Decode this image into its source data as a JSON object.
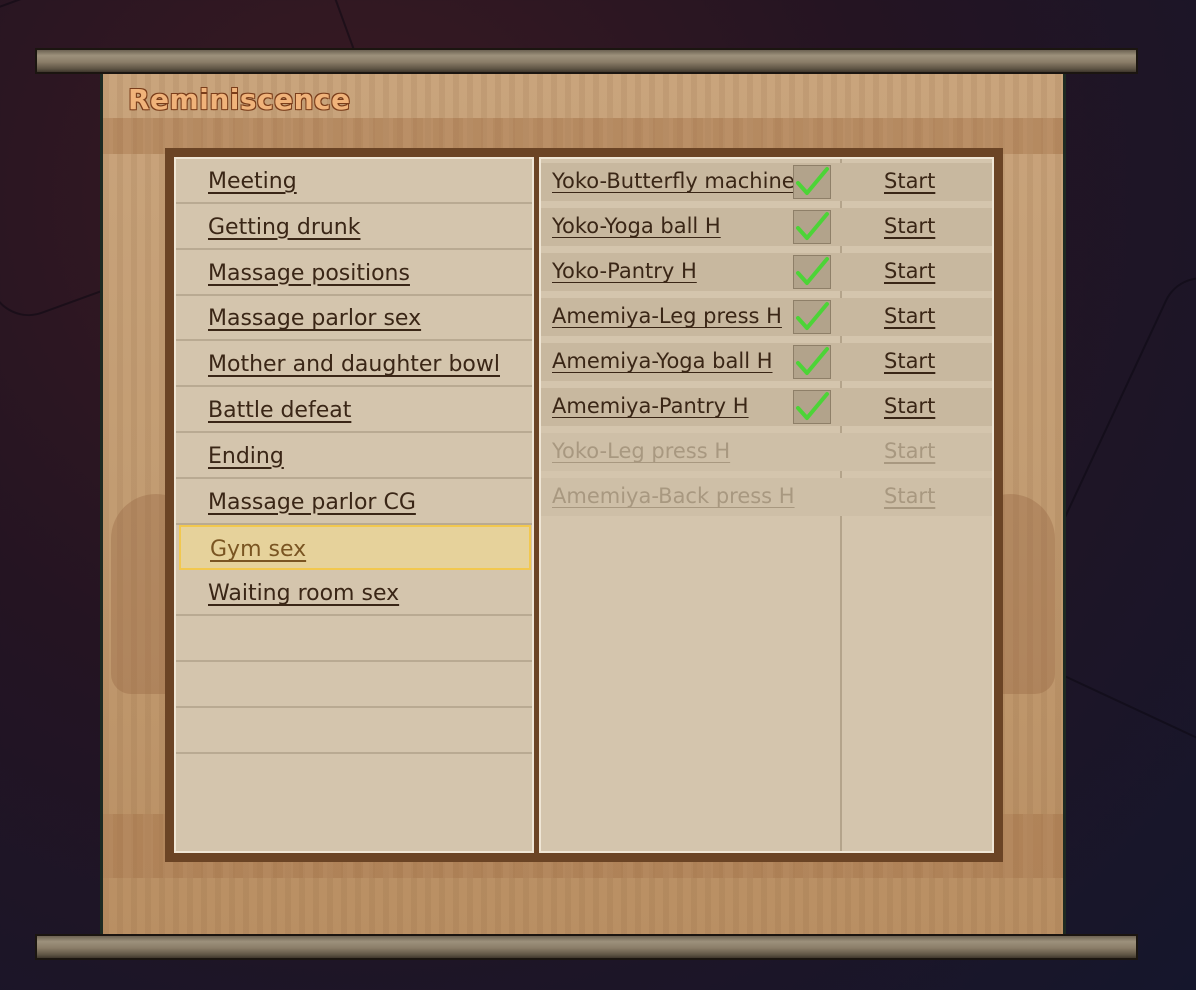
{
  "screen": {
    "title": "Reminiscence"
  },
  "categories": [
    {
      "label": "Meeting"
    },
    {
      "label": "Getting drunk"
    },
    {
      "label": "Massage positions"
    },
    {
      "label": "Massage parlor sex"
    },
    {
      "label": "Mother and daughter bowl"
    },
    {
      "label": "Battle defeat"
    },
    {
      "label": "Ending"
    },
    {
      "label": "Massage parlor CG"
    },
    {
      "label": "Gym sex",
      "selected": true
    },
    {
      "label": "Waiting room sex"
    }
  ],
  "scenes": [
    {
      "name": "Yoko-Butterfly machine H",
      "start_label": "Start",
      "viewed": true
    },
    {
      "name": "Yoko-Yoga ball H",
      "start_label": "Start",
      "viewed": true
    },
    {
      "name": "Yoko-Pantry H",
      "start_label": "Start",
      "viewed": true
    },
    {
      "name": "Amemiya-Leg press H",
      "start_label": "Start",
      "viewed": true
    },
    {
      "name": "Amemiya-Yoga ball H",
      "start_label": "Start",
      "viewed": true
    },
    {
      "name": "Amemiya-Pantry H",
      "start_label": "Start",
      "viewed": true
    },
    {
      "name": "Yoko-Leg press H",
      "start_label": "Start",
      "viewed": false
    },
    {
      "name": "Amemiya-Back press H",
      "start_label": "Start",
      "viewed": false
    }
  ],
  "colors": {
    "check_green": "#4cd437",
    "selected_border": "#f2c84e",
    "title_orange": "#f0b37a"
  },
  "icons": {
    "viewed": "checkmark-icon"
  }
}
